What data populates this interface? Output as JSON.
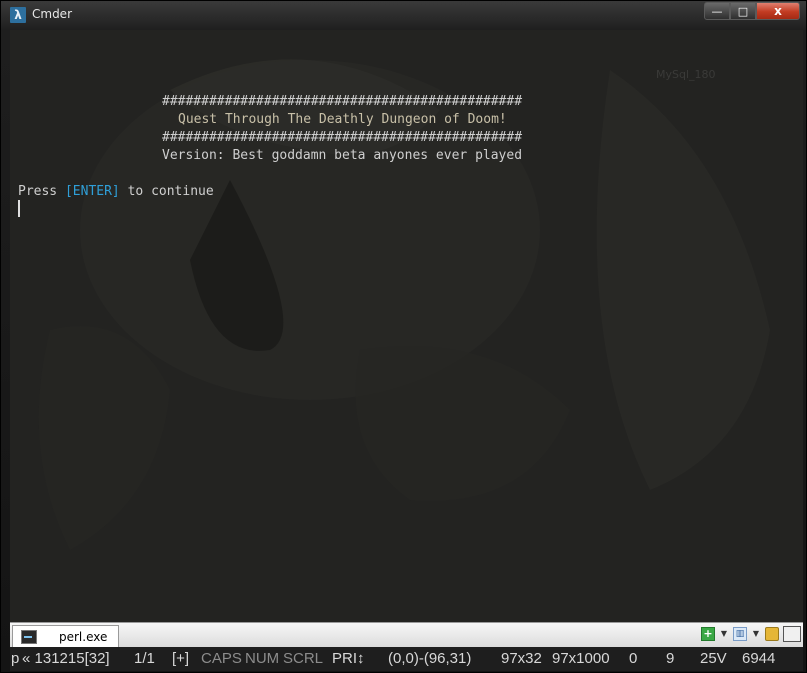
{
  "window": {
    "app_icon": "λ",
    "title": "Cmder",
    "controls": {
      "minimize": "—",
      "maximize": "□",
      "close": "x"
    }
  },
  "desktop_label": "MySql_180",
  "console": {
    "banner_top": "##############################################",
    "banner_title": "Quest Through The Deathly Dungeon of Doom!",
    "banner_bottom": "##############################################",
    "version_line": "Version: Best goddamn beta anyones ever played",
    "prompt_before": "Press ",
    "prompt_key": "[ENTER]",
    "prompt_after": " to continue"
  },
  "tabbar": {
    "tab_label": "perl.exe",
    "icons": [
      "console-icon",
      "add-console-icon",
      "dropdown-arrow-icon",
      "window-layout-icon",
      "dropdown-arrow-icon",
      "lock-icon",
      "panel-icon"
    ]
  },
  "statusbar": {
    "cursor_mode": "p",
    "build": "« 131215[32]",
    "console_index": "1/1",
    "new_flag": "[+]",
    "caps": "CAPS",
    "num": "NUM",
    "scrl": "SCRL",
    "priority": "PRI↕",
    "selection": "(0,0)-(96,31)",
    "size": "97x32",
    "buffer": "97x1000",
    "val1": "0",
    "val2": "9",
    "val3": "25V",
    "pid": "6944"
  },
  "colors": {
    "console_bg": "#232321",
    "text": "#cfcfcf",
    "highlight": "#2f9fd8",
    "close_button": "#c23b22"
  }
}
